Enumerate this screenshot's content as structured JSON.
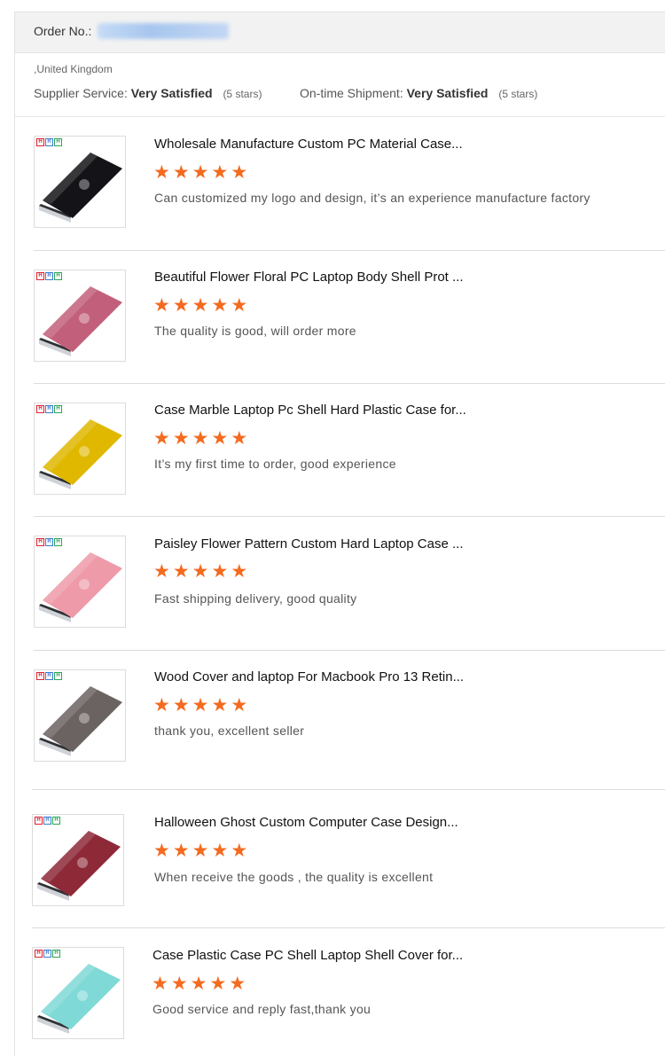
{
  "order": {
    "label": "Order No.:",
    "location": ",United Kingdom",
    "supplier_service": {
      "label": "Supplier Service:",
      "value": "Very Satisfied",
      "stars": "(5 stars)"
    },
    "on_time_shipment": {
      "label": "On-time Shipment:",
      "value": "Very Satisfied",
      "stars": "(5 stars)"
    }
  },
  "colors": {
    "star": "#f46a1f"
  },
  "items": [
    {
      "title": "Wholesale Manufacture Custom PC Material Case...",
      "rating": 5,
      "comment": "Can customized my logo and design, it’s an experience manufacture factory",
      "case_color": "#141418"
    },
    {
      "title": "Beautiful Flower Floral PC Laptop Body Shell Prot ...",
      "rating": 5,
      "comment": "The quality is good, will order more",
      "case_color": "#c2607b"
    },
    {
      "title": "Case Marble Laptop Pc Shell Hard Plastic Case for...",
      "rating": 5,
      "comment": "It’s my first time to order, good experience",
      "case_color": "#e0b800"
    },
    {
      "title": "Paisley Flower Pattern Custom Hard Laptop Case ...",
      "rating": 5,
      "comment": "Fast shipping delivery, good quality",
      "case_color": "#ee9aa8"
    },
    {
      "title": "Wood Cover and laptop For Macbook Pro 13 Retin...",
      "rating": 5,
      "comment": "thank you, excellent seller",
      "case_color": "#6b6362"
    },
    {
      "title": "Halloween Ghost Custom Computer Case Design...",
      "rating": 5,
      "comment": "When receive the goods , the quality is excellent",
      "case_color": "#8e2a38"
    },
    {
      "title": "Case Plastic Case PC Shell Laptop Shell Cover for...",
      "rating": 5,
      "comment": "Good service and reply fast,thank you",
      "case_color": "#7fd9d6"
    }
  ]
}
